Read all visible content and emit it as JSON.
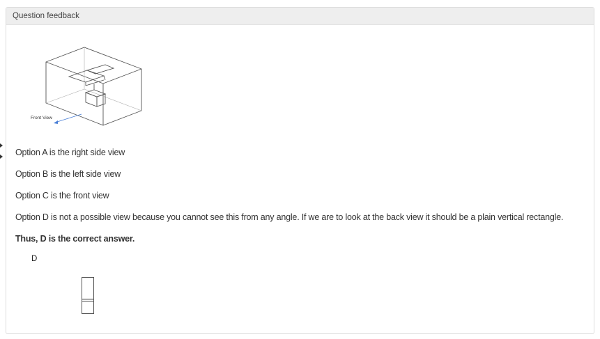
{
  "header": {
    "title": "Question feedback"
  },
  "figure": {
    "front_label": "Front View"
  },
  "explanation": {
    "lines": [
      "Option A is the right side view",
      "Option B is the left side view",
      "Option C is the front view",
      "Option D is not a possible view because you cannot see this from any angle. If we are to look at the back view it should be a plain vertical rectangle."
    ],
    "conclusion": "Thus, D is the correct answer.",
    "answer_letter": "D"
  }
}
